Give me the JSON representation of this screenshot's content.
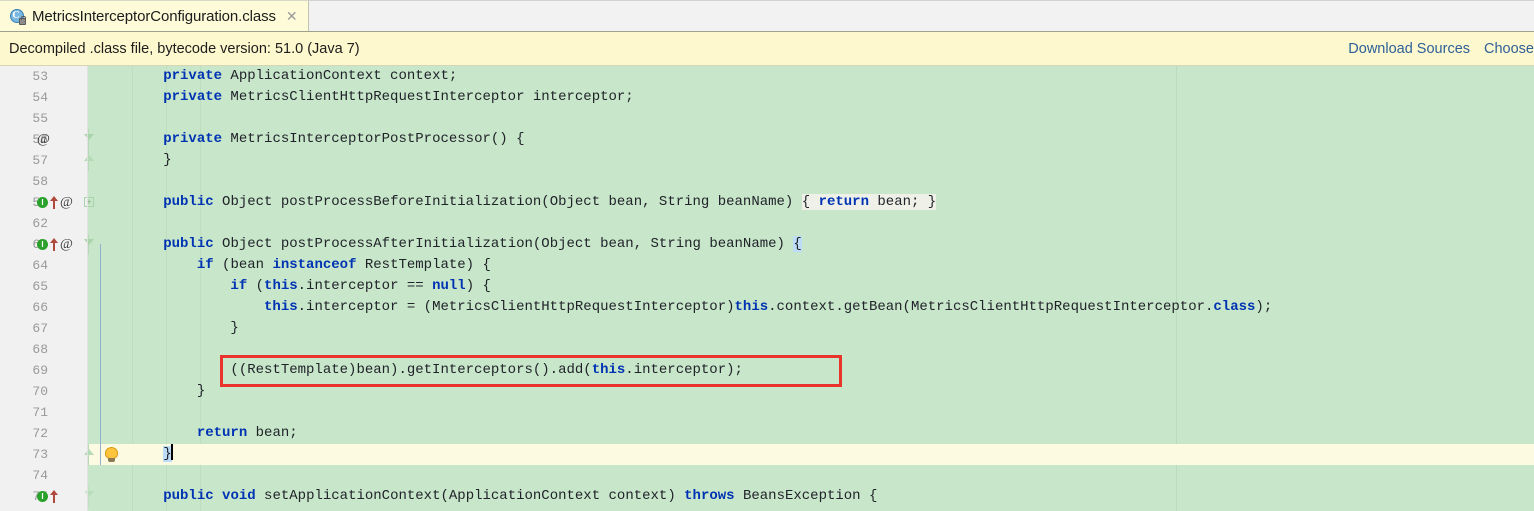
{
  "window": {
    "tab": {
      "icon": "java-class-file-icon",
      "title": "MetricsInterceptorConfiguration.class",
      "close_label": "✕"
    }
  },
  "notification": {
    "message": "Decompiled .class file, bytecode version: 51.0 (Java 7)",
    "links": [
      {
        "label": "Download Sources",
        "name": "download-sources-link"
      },
      {
        "label": "Choose",
        "name": "choose-sources-link"
      }
    ],
    "colors": {
      "background": "#fdf8cd",
      "link": "#2e6099"
    }
  },
  "editor": {
    "colors": {
      "background": "#c8e6c9",
      "gutter": "#f1f1f1",
      "keyword": "#0033b3",
      "text": "#20232a",
      "caret_line": "#fdfae2",
      "brace_match": "#bddcf7",
      "annotation_box": "#e8342a"
    },
    "annotation_box": {
      "target_line": "69",
      "label": "red-highlight-box"
    },
    "lines": [
      {
        "number": "53",
        "gutter_icons": [],
        "fold": "none",
        "caret": false,
        "segments": [
          {
            "t": "        ",
            "k": "pl"
          },
          {
            "t": "private",
            "k": "kw"
          },
          {
            "t": " ApplicationContext context;",
            "k": "pl"
          }
        ]
      },
      {
        "number": "54",
        "gutter_icons": [],
        "fold": "none",
        "caret": false,
        "segments": [
          {
            "t": "        ",
            "k": "pl"
          },
          {
            "t": "private",
            "k": "kw"
          },
          {
            "t": " MetricsClientHttpRequestInterceptor interceptor;",
            "k": "pl"
          }
        ]
      },
      {
        "number": "55",
        "gutter_icons": [],
        "fold": "none",
        "caret": false,
        "segments": []
      },
      {
        "number": "56",
        "gutter_icons": [
          "at-icon"
        ],
        "fold": "fold-region-top",
        "caret": false,
        "segments": [
          {
            "t": "        ",
            "k": "pl"
          },
          {
            "t": "private",
            "k": "kw"
          },
          {
            "t": " MetricsInterceptorPostProcessor() {",
            "k": "pl"
          }
        ]
      },
      {
        "number": "57",
        "gutter_icons": [],
        "fold": "fold-region-bottom",
        "caret": false,
        "segments": [
          {
            "t": "        }",
            "k": "pl"
          }
        ]
      },
      {
        "number": "58",
        "gutter_icons": [],
        "fold": "none",
        "caret": false,
        "segments": []
      },
      {
        "number": "59",
        "gutter_icons": [
          "implementing-method-icon",
          "overriding-method-icon",
          "at-icon"
        ],
        "fold": "fold-collapsed",
        "caret": false,
        "segments": [
          {
            "t": "        ",
            "k": "pl"
          },
          {
            "t": "public",
            "k": "kw"
          },
          {
            "t": " Object postProcessBeforeInitialization(Object bean, String beanName) ",
            "k": "pl"
          },
          {
            "t": "{ ",
            "k": "fold"
          },
          {
            "t": "return",
            "k": "kwfold"
          },
          {
            "t": " bean; }",
            "k": "fold"
          }
        ]
      },
      {
        "number": "62",
        "gutter_icons": [],
        "fold": "none",
        "caret": false,
        "segments": []
      },
      {
        "number": "63",
        "gutter_icons": [
          "implementing-method-icon",
          "overriding-method-icon",
          "at-icon"
        ],
        "fold": "fold-open",
        "caret": false,
        "segments": [
          {
            "t": "        ",
            "k": "pl"
          },
          {
            "t": "public",
            "k": "kw"
          },
          {
            "t": " Object postProcessAfterInitialization(Object bean, String beanName) ",
            "k": "pl"
          },
          {
            "t": "{",
            "k": "match"
          }
        ]
      },
      {
        "number": "64",
        "gutter_icons": [],
        "fold": "none",
        "caret": false,
        "segments": [
          {
            "t": "            ",
            "k": "pl"
          },
          {
            "t": "if",
            "k": "kw"
          },
          {
            "t": " (bean ",
            "k": "pl"
          },
          {
            "t": "instanceof",
            "k": "kw"
          },
          {
            "t": " RestTemplate) {",
            "k": "pl"
          }
        ]
      },
      {
        "number": "65",
        "gutter_icons": [],
        "fold": "none",
        "caret": false,
        "segments": [
          {
            "t": "                ",
            "k": "pl"
          },
          {
            "t": "if",
            "k": "kw"
          },
          {
            "t": " (",
            "k": "pl"
          },
          {
            "t": "this",
            "k": "kw"
          },
          {
            "t": ".interceptor == ",
            "k": "pl"
          },
          {
            "t": "null",
            "k": "kw"
          },
          {
            "t": ") {",
            "k": "pl"
          }
        ]
      },
      {
        "number": "66",
        "gutter_icons": [],
        "fold": "none",
        "caret": false,
        "segments": [
          {
            "t": "                    ",
            "k": "pl"
          },
          {
            "t": "this",
            "k": "kw"
          },
          {
            "t": ".interceptor = (MetricsClientHttpRequestInterceptor)",
            "k": "pl"
          },
          {
            "t": "this",
            "k": "kw"
          },
          {
            "t": ".context.getBean(MetricsClientHttpRequestInterceptor.",
            "k": "pl"
          },
          {
            "t": "class",
            "k": "kw"
          },
          {
            "t": ");",
            "k": "pl"
          }
        ]
      },
      {
        "number": "67",
        "gutter_icons": [],
        "fold": "none",
        "caret": false,
        "segments": [
          {
            "t": "                }",
            "k": "pl"
          }
        ]
      },
      {
        "number": "68",
        "gutter_icons": [],
        "fold": "none",
        "caret": false,
        "segments": []
      },
      {
        "number": "69",
        "gutter_icons": [],
        "fold": "none",
        "caret": false,
        "segments": [
          {
            "t": "                ((RestTemplate)bean).getInterceptors().add(",
            "k": "pl"
          },
          {
            "t": "this",
            "k": "kw"
          },
          {
            "t": ".interceptor);",
            "k": "pl"
          }
        ]
      },
      {
        "number": "70",
        "gutter_icons": [],
        "fold": "none",
        "caret": false,
        "segments": [
          {
            "t": "            }",
            "k": "pl"
          }
        ]
      },
      {
        "number": "71",
        "gutter_icons": [],
        "fold": "none",
        "caret": false,
        "segments": []
      },
      {
        "number": "72",
        "gutter_icons": [],
        "fold": "none",
        "caret": false,
        "segments": [
          {
            "t": "            ",
            "k": "pl"
          },
          {
            "t": "return",
            "k": "kw"
          },
          {
            "t": " bean;",
            "k": "pl"
          }
        ]
      },
      {
        "number": "73",
        "gutter_icons": [
          "intention-bulb-icon"
        ],
        "fold": "fold-end",
        "caret": true,
        "segments": [
          {
            "t": "        ",
            "k": "pl"
          },
          {
            "t": "}",
            "k": "match"
          }
        ]
      },
      {
        "number": "74",
        "gutter_icons": [],
        "fold": "none",
        "caret": false,
        "segments": []
      },
      {
        "number": "75",
        "gutter_icons": [
          "implementing-method-icon",
          "overriding-method-icon"
        ],
        "fold": "fold-open-dim",
        "caret": false,
        "segments": [
          {
            "t": "        ",
            "k": "pl"
          },
          {
            "t": "public",
            "k": "kw"
          },
          {
            "t": " ",
            "k": "pl"
          },
          {
            "t": "void",
            "k": "kw"
          },
          {
            "t": " setApplicationContext(ApplicationContext context) ",
            "k": "pl"
          },
          {
            "t": "throws",
            "k": "kw"
          },
          {
            "t": " BeansException {",
            "k": "pl"
          }
        ]
      }
    ]
  }
}
